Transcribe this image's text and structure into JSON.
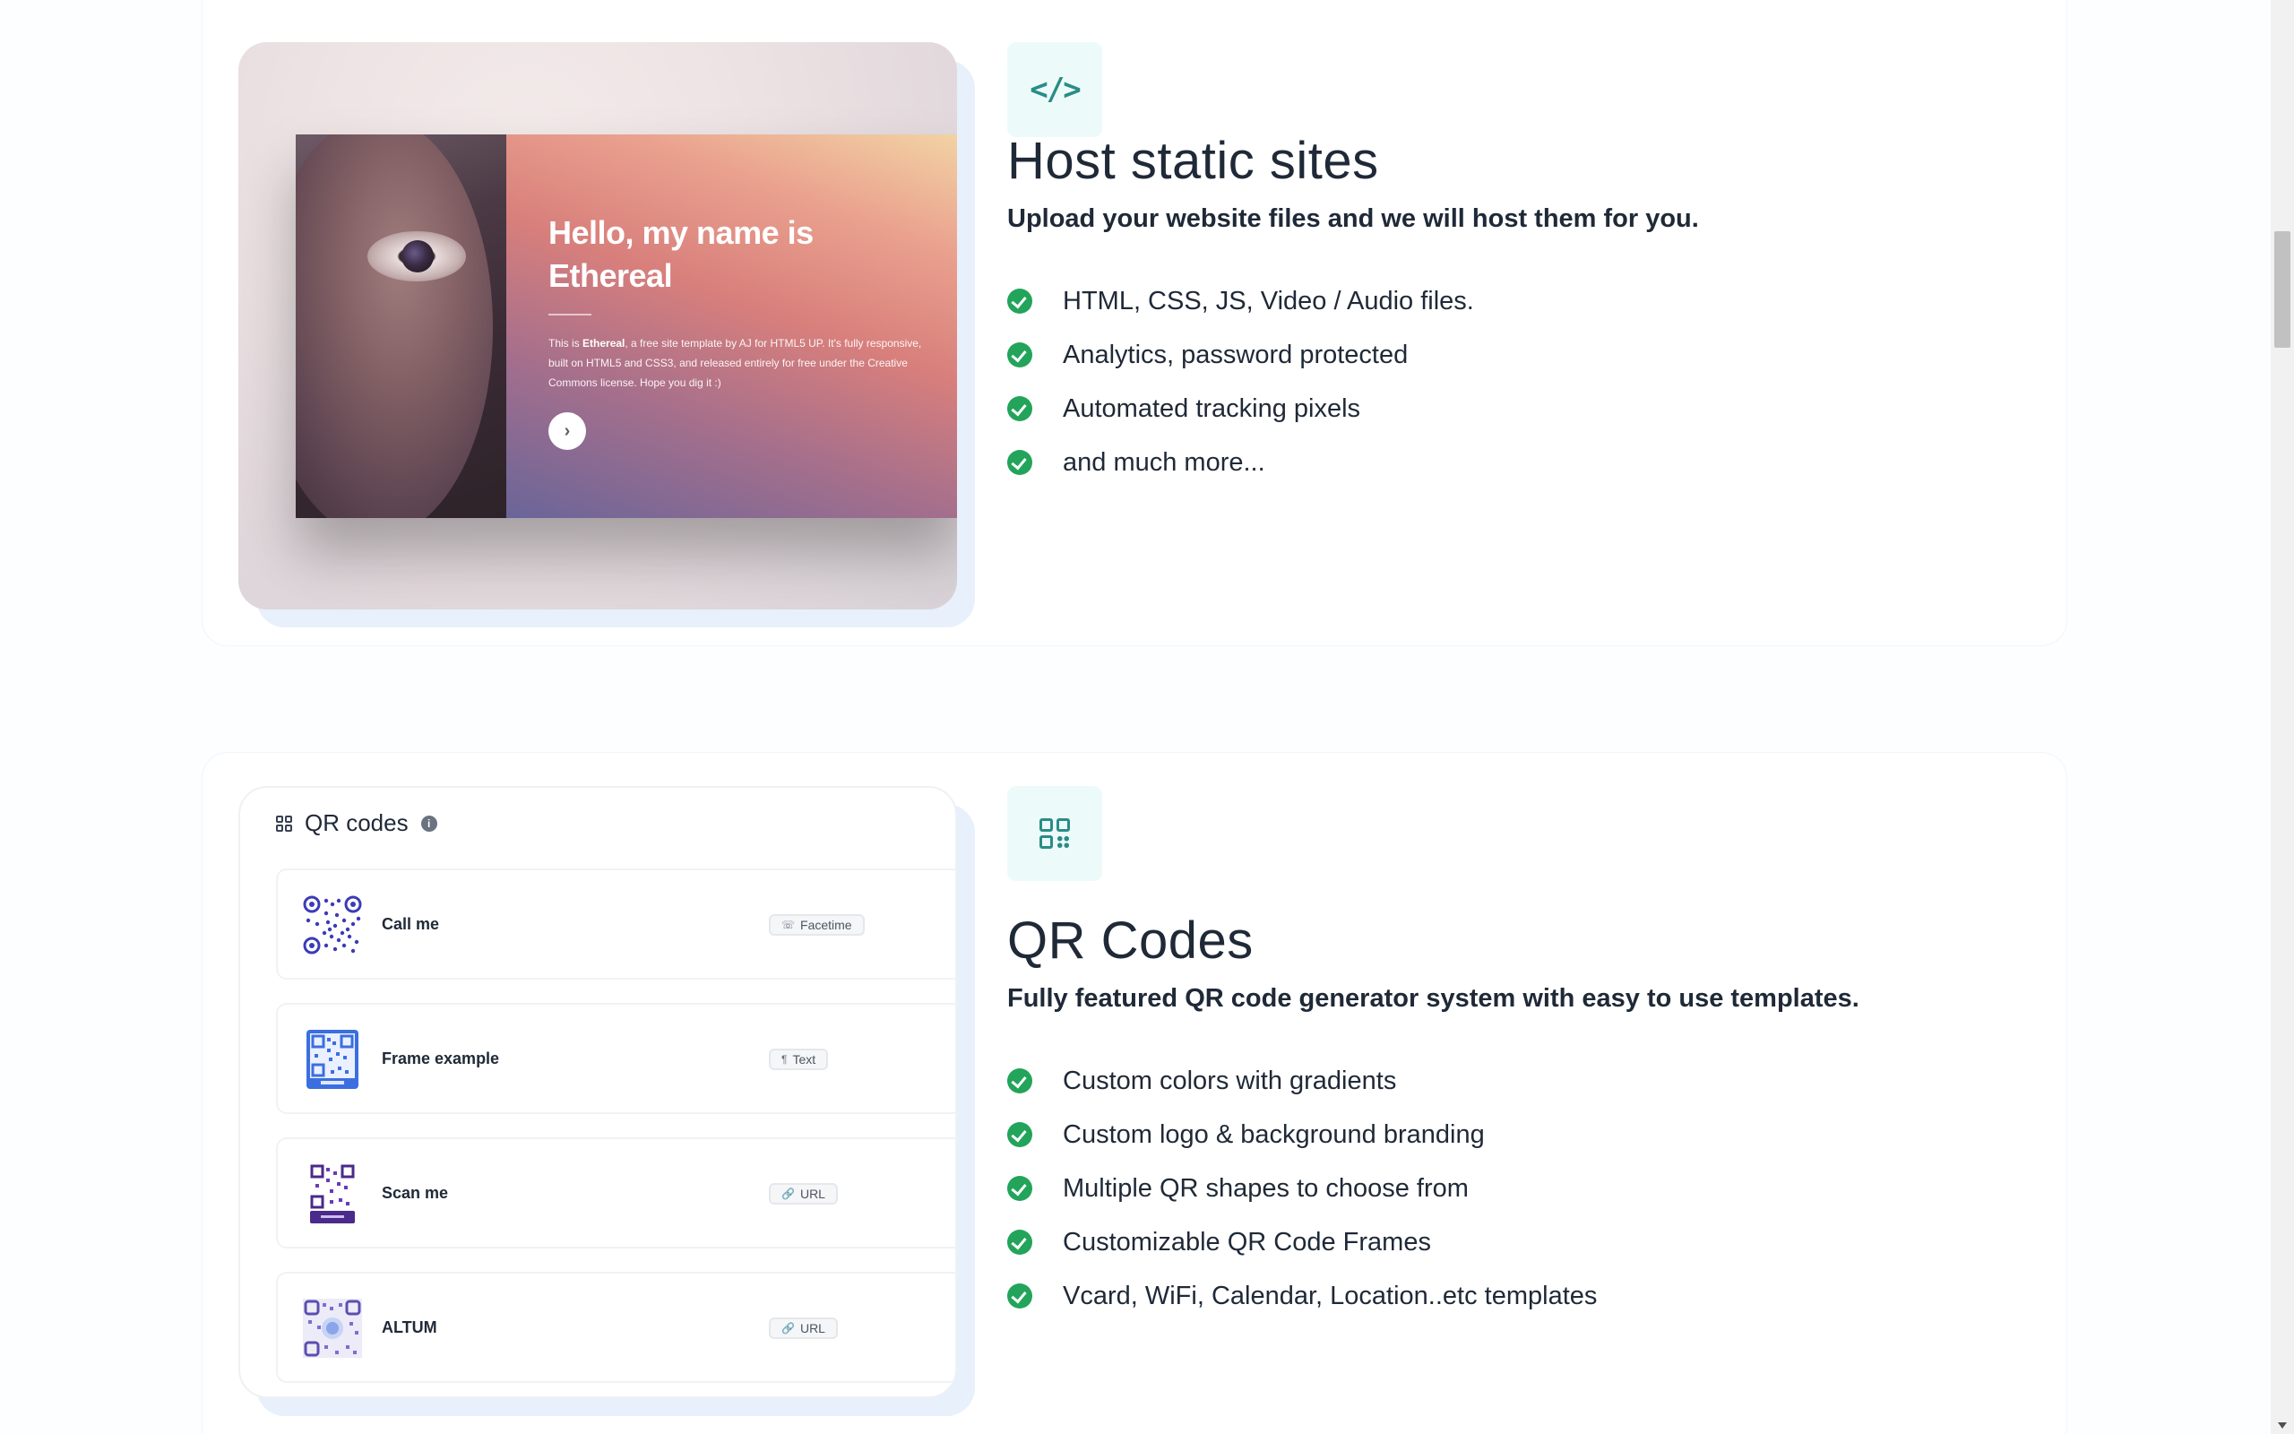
{
  "sections": [
    {
      "icon": "code-icon",
      "heading": "Host static sites",
      "subheading": "Upload your website files and we will host them for you.",
      "features": [
        "HTML, CSS, JS, Video / Audio files.",
        "Analytics, password protected",
        "Automated tracking pixels",
        "and much more..."
      ],
      "preview": {
        "hero_title": "Hello, my name is Ethereal",
        "hero_desc_lead": "This is ",
        "hero_desc_name": "Ethereal",
        "hero_desc_rest": ", a free site template by AJ for HTML5 UP. It's fully responsive, built on HTML5 and CSS3, and released entirely for free under the Creative Commons license. Hope you dig it :)",
        "next_glyph": "›"
      }
    },
    {
      "icon": "qr-code-icon",
      "heading": "QR Codes",
      "subheading": "Fully featured QR code generator system with easy to use templates.",
      "features": [
        "Custom colors with gradients",
        "Custom logo & background branding",
        "Multiple QR shapes to choose from",
        "Customizable QR Code Frames",
        "Vcard, WiFi, Calendar, Location..etc templates"
      ],
      "preview": {
        "title": "QR codes",
        "info_glyph": "i",
        "rows": [
          {
            "name": "Call me",
            "badge": "Facetime",
            "badge_icon": "☏"
          },
          {
            "name": "Frame example",
            "badge": "Text",
            "badge_icon": "¶"
          },
          {
            "name": "Scan me",
            "badge": "URL",
            "badge_icon": "🔗"
          },
          {
            "name": "ALTUM",
            "badge": "URL",
            "badge_icon": "🔗"
          }
        ]
      }
    }
  ],
  "colors": {
    "accent_teal": "#2a8c86",
    "check_green": "#22a45a",
    "icon_tile_bg": "#ecfbfa"
  }
}
